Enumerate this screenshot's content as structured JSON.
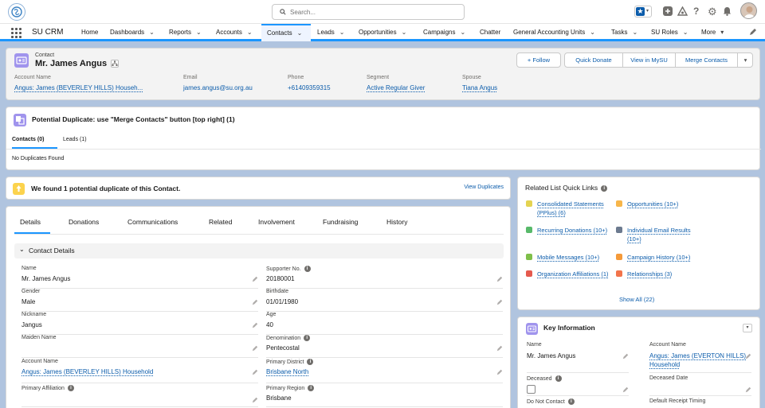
{
  "header": {
    "search_placeholder": "Search...",
    "icons": [
      "favorites-star-icon",
      "add-icon",
      "trailhead-icon",
      "help-icon",
      "setup-gear-icon",
      "notifications-bell-icon",
      "user-avatar"
    ]
  },
  "nav": {
    "app_name": "SU CRM",
    "items": [
      {
        "label": "Home",
        "chevron": false
      },
      {
        "label": "Dashboards",
        "chevron": true
      },
      {
        "label": "Reports",
        "chevron": true
      },
      {
        "label": "Accounts",
        "chevron": true
      },
      {
        "label": "Contacts",
        "chevron": true,
        "active": true
      },
      {
        "label": "Leads",
        "chevron": true
      },
      {
        "label": "Opportunities",
        "chevron": true
      },
      {
        "label": "Campaigns",
        "chevron": true
      },
      {
        "label": "Chatter",
        "chevron": false
      },
      {
        "label": "General Accounting Units",
        "chevron": true
      },
      {
        "label": "Tasks",
        "chevron": true
      },
      {
        "label": "SU Roles",
        "chevron": true
      },
      {
        "label": "More",
        "chevron": true
      }
    ]
  },
  "record": {
    "object_type": "Contact",
    "name": "Mr. James Angus",
    "buttons": {
      "follow": "+ Follow",
      "quick_donate": "Quick Donate",
      "view_in_mysu": "View in MySU",
      "merge_contacts": "Merge Contacts"
    },
    "highlights": [
      {
        "label": "Account Name",
        "value": "Angus: James (BEVERLEY HILLS) Househ..."
      },
      {
        "label": "Email",
        "value": "james.angus@su.org.au"
      },
      {
        "label": "Phone",
        "value": "+61409359315"
      },
      {
        "label": "Segment",
        "value": "Active Regular Giver"
      },
      {
        "label": "Spouse",
        "value": "Tiana Angus"
      }
    ]
  },
  "duplicates": {
    "title": "Potential Duplicate: use \"Merge Contacts\" button [top right] (1)",
    "tabs": [
      "Contacts (0)",
      "Leads (1)"
    ],
    "empty_text": "No Duplicates Found"
  },
  "alert": {
    "text": "We found 1 potential duplicate of this Contact.",
    "link": "View Duplicates"
  },
  "main": {
    "tabs": [
      "Details",
      "Donations",
      "Communications",
      "Related",
      "Involvement",
      "Fundraising",
      "History"
    ],
    "active_tab": "Details",
    "section_title": "Contact Details",
    "left_fields": [
      {
        "label": "Name",
        "value": "Mr. James Angus",
        "link": false,
        "info": false
      },
      {
        "label": "Gender",
        "value": "Male",
        "link": false,
        "info": false
      },
      {
        "label": "Nickname",
        "value": "Jangus",
        "link": false,
        "info": false
      },
      {
        "label": "Maiden Name",
        "value": "",
        "link": false,
        "info": false
      },
      {
        "label": "Account Name",
        "value": "Angus: James (BEVERLEY HILLS) Household",
        "link": true,
        "info": false
      },
      {
        "label": "Primary Affiliation",
        "value": "",
        "link": false,
        "info": true
      }
    ],
    "right_fields": [
      {
        "label": "Supporter No.",
        "value": "20180001",
        "link": false,
        "info": true
      },
      {
        "label": "Birthdate",
        "value": "01/01/1980",
        "link": false,
        "info": false
      },
      {
        "label": "Age",
        "value": "40",
        "link": false,
        "info": false
      },
      {
        "label": "Denomination",
        "value": "Pentecostal",
        "link": false,
        "info": true
      },
      {
        "label": "Primary District",
        "value": "Brisbane North",
        "link": true,
        "info": true
      },
      {
        "label": "Primary Region",
        "value": "Brisbane",
        "link": false,
        "info": true
      }
    ]
  },
  "related_links": {
    "title": "Related List Quick Links",
    "items": [
      {
        "label": "Consolidated Statements (PPlus) (6)",
        "color": "#e4d351"
      },
      {
        "label": "Opportunities (10+)",
        "color": "#f7b64a"
      },
      {
        "label": "Recurring Donations (10+)",
        "color": "#58b96a"
      },
      {
        "label": "Individual Email Results (10+)",
        "color": "#6c7a8f"
      },
      {
        "label": "Mobile Messages (10+)",
        "color": "#7fbf4a"
      },
      {
        "label": "Campaign History (10+)",
        "color": "#f59a3a"
      },
      {
        "label": "Organization Affiliations (1)",
        "color": "#e55a4e"
      },
      {
        "label": "Relationships (3)",
        "color": "#f2744b"
      }
    ],
    "show_all": "Show All (22)"
  },
  "key_info": {
    "title": "Key Information",
    "name_label": "Name",
    "name_value": "Mr. James Angus",
    "account_label": "Account Name",
    "account_value": "Angus: James (EVERTON HILLS) Household",
    "deceased_label": "Deceased",
    "deceased_date_label": "Deceased Date",
    "do_not_contact_label": "Do Not Contact",
    "receipt_timing_label": "Default Receipt Timing"
  }
}
